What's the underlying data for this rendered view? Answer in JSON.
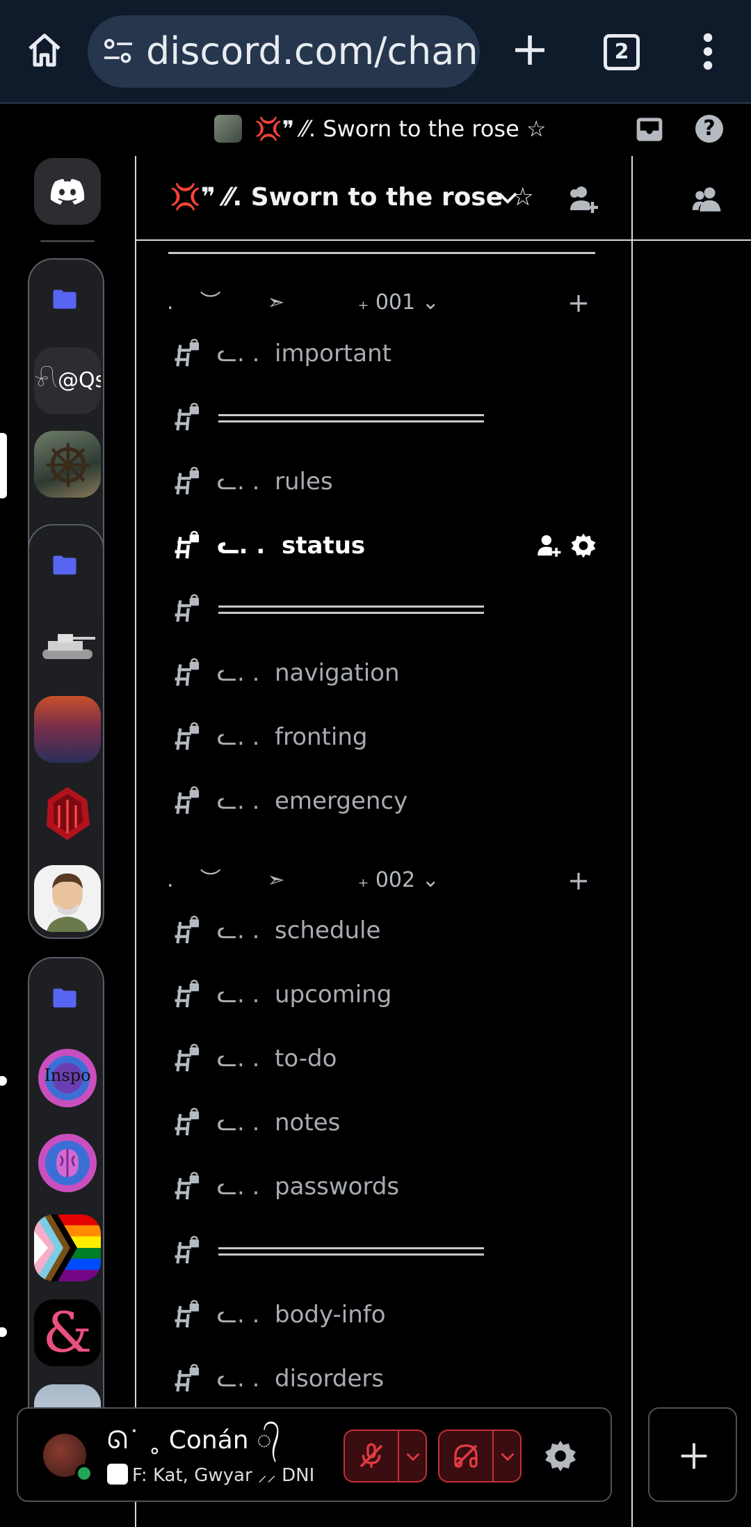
{
  "browser": {
    "url": "discord.com/chanr",
    "tab_count": "2"
  },
  "top_bar": {
    "server_title": "💢❞ ⁄⁄. Sworn to the rose ☆",
    "help": "?"
  },
  "panel": {
    "server_name": "💢❞ ⁄⁄. Sworn to the rose ☆"
  },
  "categories": [
    {
      "label": ".    ︶       ➣           ₊ 001 ⌄"
    },
    {
      "label": ".    ︶       ➣           ₊ 002 ⌄"
    }
  ],
  "channels": [
    {
      "name": "ᓚ. .  important"
    },
    {
      "name": ""
    },
    {
      "name": "ᓚ. .  rules"
    },
    {
      "name": "ᓚ. .  status"
    },
    {
      "name": ""
    },
    {
      "name": "ᓚ. .  navigation"
    },
    {
      "name": "ᓚ. .  fronting"
    },
    {
      "name": "ᓚ. .  emergency"
    },
    {
      "name": "ᓚ. .  schedule"
    },
    {
      "name": "ᓚ. .  upcoming"
    },
    {
      "name": "ᓚ. .  to-do"
    },
    {
      "name": "ᓚ. .  notes"
    },
    {
      "name": "ᓚ. .  passwords"
    },
    {
      "name": ""
    },
    {
      "name": "ᓚ. .  body-info"
    },
    {
      "name": "ᓚ. .  disorders"
    }
  ],
  "servers": {
    "text_server": "𓍯@Qs",
    "inspo": "Inspo",
    "ampersand": "&"
  },
  "user": {
    "name": "ᘏ˙ ˳ Conán ᭄",
    "subtitle": "F: Kat, Gwyar ⸝⸝ DNI"
  },
  "colors": {
    "accent": "#5865f2",
    "danger": "#c4313a",
    "online": "#23a55a"
  }
}
